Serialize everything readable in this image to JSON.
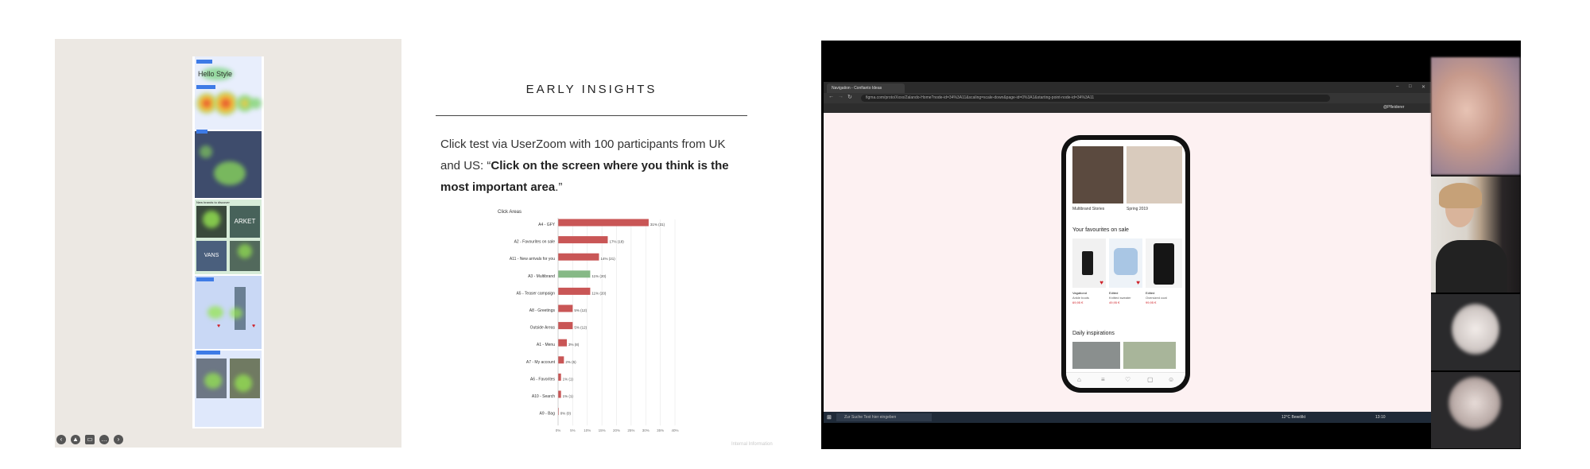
{
  "slide": {
    "title": "EARLY INSIGHTS",
    "body_intro": "Click test via UserZoom with 100 participants from UK and US: “",
    "body_bold": "Click on the screen where you think is the most important area",
    "body_end": ".”",
    "watermark": "Internal Information"
  },
  "heatmap": {
    "tiles": {
      "logo": "Hello Style",
      "brands": "New brands to discover",
      "arket": "ARKET",
      "vans": "VANS"
    }
  },
  "nav_icons": [
    "chevron-left-icon",
    "triangle-icon",
    "cc-icon",
    "more-icon",
    "chevron-right-icon"
  ],
  "chart_data": {
    "type": "bar",
    "title": "Click Areas",
    "categories": [
      "A4 - GFY",
      "A2 - Favourites on sale",
      "A11 - New arrivals for you",
      "A3 - Multibrand",
      "A5 - Teaser campaign",
      "A8 - Greetings",
      "Outside Areas",
      "A1 - Menu",
      "A7 - My account",
      "A6 - Favorites",
      "A10 - Search",
      "A9 - Bag"
    ],
    "values": [
      31,
      17,
      14,
      11,
      11,
      5,
      5,
      3,
      2,
      1,
      1,
      0
    ],
    "value_labels": [
      "31% (31)",
      "17% (18)",
      "14% (21)",
      "11% (20)",
      "11% (20)",
      "5% (12)",
      "5% (12)",
      "3% (8)",
      "2% (5)",
      "1% (1)",
      "1% (1)",
      "0% (0)"
    ],
    "highlight_index": 3,
    "colors": {
      "bar": "#c95656",
      "highlight": "#86b986"
    },
    "xlim": [
      0,
      40
    ],
    "xticks": [
      "0%",
      "5%",
      "10%",
      "15%",
      "20%",
      "25%",
      "30%",
      "35%",
      "40%"
    ],
    "grid": true
  },
  "browser": {
    "tab_title": "Navigation - Confianto Ideas",
    "url": "figma.com/proto/Xxxx/Zalando-Home?node-id=34%3A11&scaling=scale-down&page-id=0%3A1&starting-point-node-id=34%3A11",
    "profile": "@Pfleiderer",
    "taskbar_search": "Zur Suche Text hier eingeben",
    "weather": "12°C Bewölkt",
    "clock": "13:10"
  },
  "phone": {
    "caption_left": "Multibrand Stories",
    "caption_right": "Spring 2019",
    "section_sale": "Your favourites on sale",
    "products": [
      {
        "brand": "Vagabond",
        "name": "Ankle boots",
        "price": "69,95 €"
      },
      {
        "brand": "Edited",
        "name": "Knitted sweater",
        "price": "49,95 €"
      },
      {
        "brand": "Edited",
        "name": "Oversized coat",
        "price": "99,95 €"
      }
    ],
    "section_inspo": "Daily inspirations"
  },
  "colors": {
    "accent_red": "#c95656",
    "accent_green": "#86b986",
    "heat_blue": "#3e7be6",
    "canvas_pink": "#fdf1f2"
  }
}
